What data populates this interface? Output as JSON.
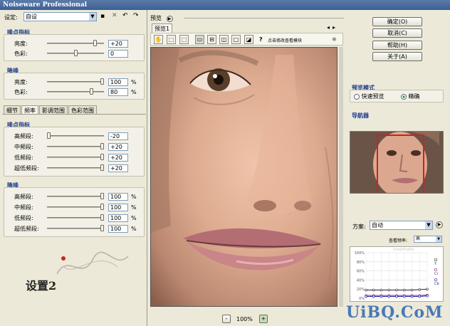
{
  "app_title": "Noiseware Professional",
  "settings": {
    "label": "设定:",
    "preset": "自设"
  },
  "noise_level": {
    "title": "噪点指标",
    "rows": [
      {
        "label": "亮度:",
        "value": "+20",
        "level": 0.86
      },
      {
        "label": "色彩:",
        "value": "0",
        "level": 0.5
      }
    ]
  },
  "noise_reduction": {
    "title": "降噪",
    "rows": [
      {
        "label": "亮度:",
        "value": "100",
        "unit": "%",
        "level": 1.0
      },
      {
        "label": "色彩:",
        "value": "80",
        "unit": "%",
        "level": 0.8
      }
    ]
  },
  "tabs": [
    "细节",
    "频率",
    "影调范围",
    "色彩范围"
  ],
  "active_tab": 1,
  "freq_noise_level": {
    "title": "噪点指标",
    "rows": [
      {
        "label": "高频段:",
        "value": "-20",
        "level": 0.0
      },
      {
        "label": "中频段:",
        "value": "+20",
        "level": 1.0
      },
      {
        "label": "低频段:",
        "value": "+20",
        "level": 1.0
      },
      {
        "label": "超低频段:",
        "value": "+20",
        "level": 1.0
      }
    ]
  },
  "freq_noise_reduction": {
    "title": "降噪",
    "rows": [
      {
        "label": "高频段:",
        "value": "100",
        "unit": "%",
        "level": 1.0
      },
      {
        "label": "中频段:",
        "value": "100",
        "unit": "%",
        "level": 1.0
      },
      {
        "label": "低频段:",
        "value": "100",
        "unit": "%",
        "level": 1.0
      },
      {
        "label": "超低频段:",
        "value": "100",
        "unit": "%",
        "level": 1.0
      }
    ]
  },
  "caption": "设置2",
  "preview": {
    "header": "预览",
    "tab": "预览1",
    "toolbar_text": "点击修改查看模块",
    "zoom": "100%",
    "zoom_out": "-",
    "zoom_in": "+"
  },
  "buttons": {
    "ok": "确定(O)",
    "cancel": "取消(C)",
    "help": "帮助(H)",
    "about": "关于(A)"
  },
  "preview_mode": {
    "title": "预览模式",
    "options": [
      "快速预览",
      "精确"
    ],
    "selected": 1
  },
  "navigator": {
    "title": "导航器"
  },
  "scheme": {
    "label": "方案:",
    "value": "自动",
    "sub_label": "查看频率:",
    "sub_value": "高",
    "watermark": "IntelliProfile"
  },
  "chart_data": {
    "type": "line",
    "y_ticks": [
      "100%",
      "80%",
      "60%",
      "40%",
      "20%",
      "0%"
    ],
    "ylim": [
      0,
      100
    ],
    "legend": [
      "Y",
      "Cr",
      "Cb"
    ],
    "series": [
      {
        "name": "Y",
        "values": [
          18,
          18,
          18,
          18,
          18,
          18,
          18,
          19,
          20
        ],
        "color": "#333333"
      },
      {
        "name": "Cr",
        "values": [
          6,
          6,
          6,
          6,
          6,
          6,
          6,
          6,
          7
        ],
        "color": "#8a2a8a"
      },
      {
        "name": "Cb",
        "values": [
          4,
          4,
          4,
          4,
          4,
          4,
          4,
          4,
          5
        ],
        "color": "#2a2a9a"
      }
    ]
  },
  "site_watermark": "UiBQ.CoM",
  "colors": {
    "group_title": "#1e3c8c",
    "accent_red": "#cc2222"
  }
}
